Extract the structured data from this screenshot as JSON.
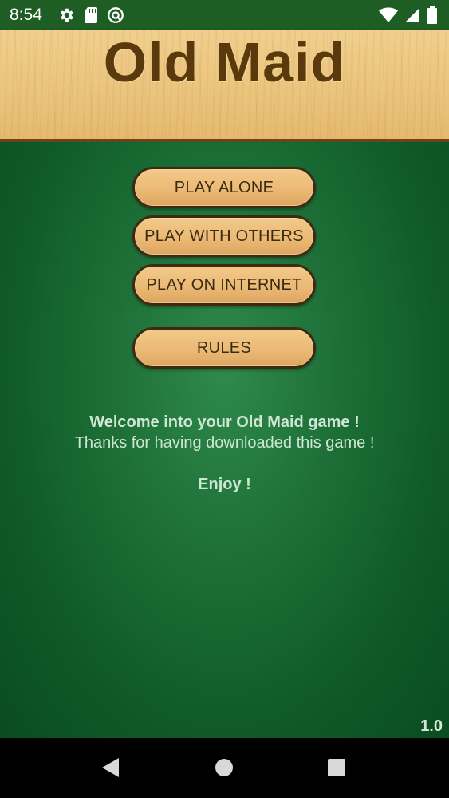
{
  "status_bar": {
    "time": "8:54",
    "icons_left": [
      "gear-icon",
      "sd-card-icon",
      "no-disturb-icon"
    ],
    "icons_right": [
      "wifi-icon",
      "signal-icon",
      "battery-icon"
    ]
  },
  "header": {
    "title": "Old Maid"
  },
  "menu": {
    "play_alone": "PLAY ALONE",
    "play_with_others": "PLAY WITH OTHERS",
    "play_on_internet": "PLAY ON INTERNET",
    "rules": "RULES"
  },
  "welcome": {
    "line1": "Welcome into your Old Maid game !",
    "line2": "Thanks for having downloaded this game !",
    "line3": "Enjoy !"
  },
  "version": "1.0",
  "nav_bar": {
    "icons": [
      "back-icon",
      "home-icon",
      "recents-icon"
    ]
  },
  "colors": {
    "felt_green": "#1e7038",
    "button_fill": "#eab873",
    "title_text": "#5a3a0c"
  }
}
